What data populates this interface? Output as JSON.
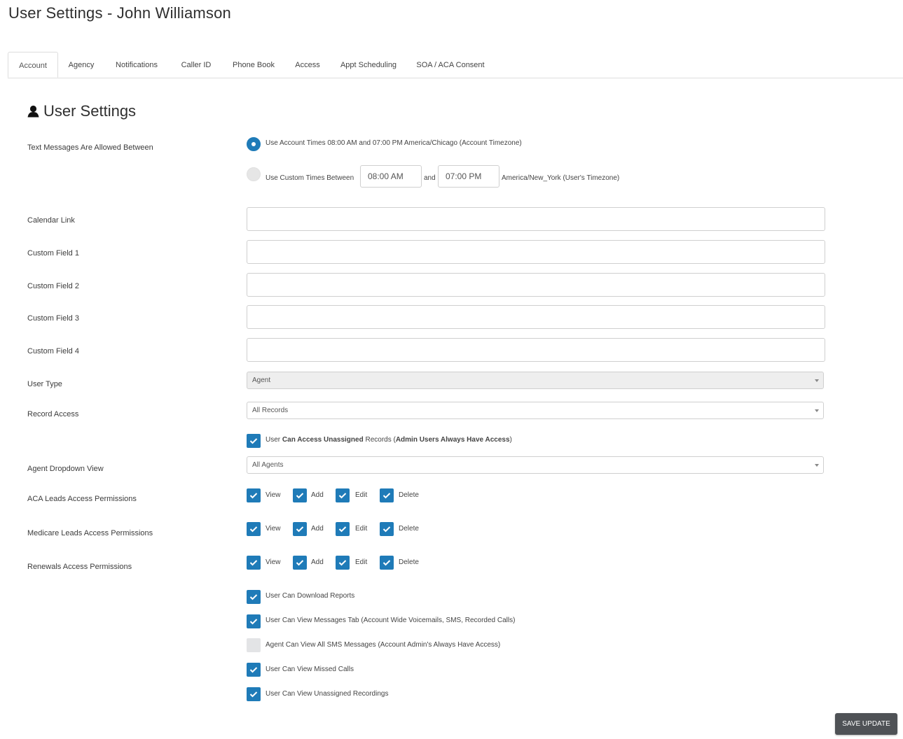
{
  "page": {
    "title": "User Settings - John Williamson"
  },
  "tabs": [
    {
      "label": "Account"
    },
    {
      "label": "Agency"
    },
    {
      "label": "Notifications"
    },
    {
      "label": "Caller ID"
    },
    {
      "label": "Phone Book"
    },
    {
      "label": "Access"
    },
    {
      "label": "Appt Scheduling"
    },
    {
      "label": "SOA / ACA Consent"
    }
  ],
  "active_tab": "Account",
  "section": {
    "title": "User Settings",
    "icon": "user-icon"
  },
  "text_messages": {
    "label": "Text Messages Are Allowed Between",
    "option_account": "Use Account Times 08:00 AM and 07:00 PM America/Chicago (Account Timezone)",
    "option_custom_prefix": "Use Custom Times Between",
    "custom_start": "08:00 AM",
    "and_text": "and",
    "custom_end": "07:00 PM",
    "custom_timezone": "America/New_York (User's Timezone)",
    "selected": "account"
  },
  "fields": {
    "calendar_link": {
      "label": "Calendar Link",
      "value": ""
    },
    "custom_field_1": {
      "label": "Custom Field 1",
      "value": ""
    },
    "custom_field_2": {
      "label": "Custom Field 2",
      "value": ""
    },
    "custom_field_3": {
      "label": "Custom Field 3",
      "value": ""
    },
    "custom_field_4": {
      "label": "Custom Field 4",
      "value": ""
    }
  },
  "user_type": {
    "label": "User Type",
    "value": "Agent",
    "disabled": true
  },
  "record_access": {
    "label": "Record Access",
    "value": "All Records"
  },
  "unassigned_access": {
    "part1": "User ",
    "part2": "Can Access Unassigned",
    "part3": " Records (",
    "part4": "Admin Users Always Have Access",
    "part5": ")",
    "checked": true
  },
  "agent_dropdown": {
    "label": "Agent Dropdown View",
    "value": "All Agents"
  },
  "permission_labels": {
    "view": "View",
    "add": "Add",
    "edit": "Edit",
    "delete": "Delete"
  },
  "permissions": [
    {
      "label": "ACA Leads Access Permissions",
      "view": true,
      "add": true,
      "edit": true,
      "delete": true
    },
    {
      "label": "Medicare Leads Access Permissions",
      "view": true,
      "add": true,
      "edit": true,
      "delete": true
    },
    {
      "label": "Renewals Access Permissions",
      "view": true,
      "add": true,
      "edit": true,
      "delete": true
    }
  ],
  "options": [
    {
      "label": "User Can Download Reports",
      "checked": true
    },
    {
      "label": "User Can View Messages Tab (Account Wide Voicemails, SMS, Recorded Calls)",
      "checked": true
    },
    {
      "label": "Agent Can View All SMS Messages (Account Admin's Always Have Access)",
      "checked": false
    },
    {
      "label": "User Can View Missed Calls",
      "checked": true
    },
    {
      "label": "User Can View Unassigned Recordings",
      "checked": true
    }
  ],
  "save_button": {
    "label": "SAVE UPDATE"
  },
  "colors": {
    "accent": "#1f7bb8",
    "button": "#4f5256",
    "unchecked": "#e3e4e6"
  }
}
